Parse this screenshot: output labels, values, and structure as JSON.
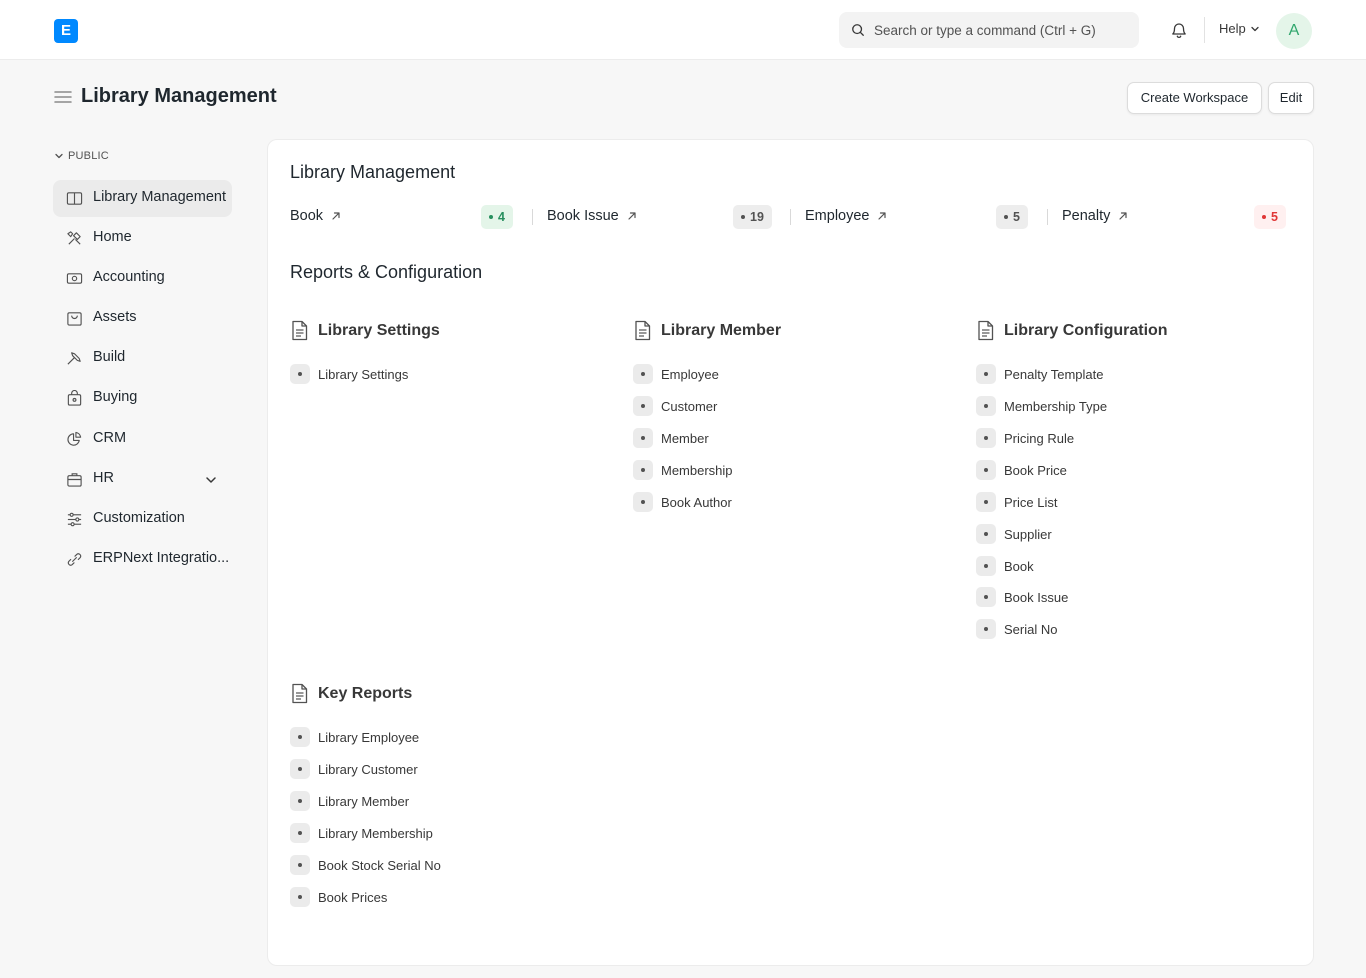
{
  "navbar": {
    "logo_letter": "E",
    "search_placeholder": "Search or type a command (Ctrl + G)",
    "help_label": "Help",
    "avatar_initial": "A"
  },
  "header": {
    "title": "Library Management",
    "create_workspace_label": "Create Workspace",
    "edit_label": "Edit"
  },
  "sidebar": {
    "section_label": "PUBLIC",
    "items": [
      {
        "label": "Library Management",
        "icon": "book-icon"
      },
      {
        "label": "Home",
        "icon": "tools-icon"
      },
      {
        "label": "Accounting",
        "icon": "accounting-icon"
      },
      {
        "label": "Assets",
        "icon": "assets-icon"
      },
      {
        "label": "Build",
        "icon": "build-icon"
      },
      {
        "label": "Buying",
        "icon": "buying-icon"
      },
      {
        "label": "CRM",
        "icon": "crm-icon"
      },
      {
        "label": "HR",
        "icon": "hr-icon"
      },
      {
        "label": "Customization",
        "icon": "customization-icon"
      },
      {
        "label": "ERPNext Integratio..."
      }
    ]
  },
  "main": {
    "title": "Library Management",
    "shortcuts": [
      {
        "label": "Book",
        "count": "4",
        "status_color": "#278f5e"
      },
      {
        "label": "Book Issue",
        "count": "19",
        "status_color": "#525252"
      },
      {
        "label": "Employee",
        "count": "5",
        "status_color": "#525252"
      },
      {
        "label": "Penalty",
        "count": "5",
        "status_color": "#e03636"
      }
    ],
    "reports_title": "Reports & Configuration",
    "cards": {
      "library_settings": {
        "title": "Library Settings",
        "links": [
          "Library Settings"
        ]
      },
      "library_member": {
        "title": "Library Member",
        "links": [
          "Employee",
          "Customer",
          "Member",
          "Membership",
          "Book Author"
        ]
      },
      "library_configuration": {
        "title": "Library Configuration",
        "links": [
          "Penalty Template",
          "Membership Type",
          "Pricing Rule",
          "Book Price",
          "Price List",
          "Supplier",
          "Book",
          "Book Issue",
          "Serial No"
        ]
      },
      "key_reports": {
        "title": "Key Reports",
        "links": [
          "Library Employee",
          "Library Customer",
          "Library Member",
          "Library Membership",
          "Book Stock Serial No",
          "Book Prices"
        ]
      }
    }
  }
}
